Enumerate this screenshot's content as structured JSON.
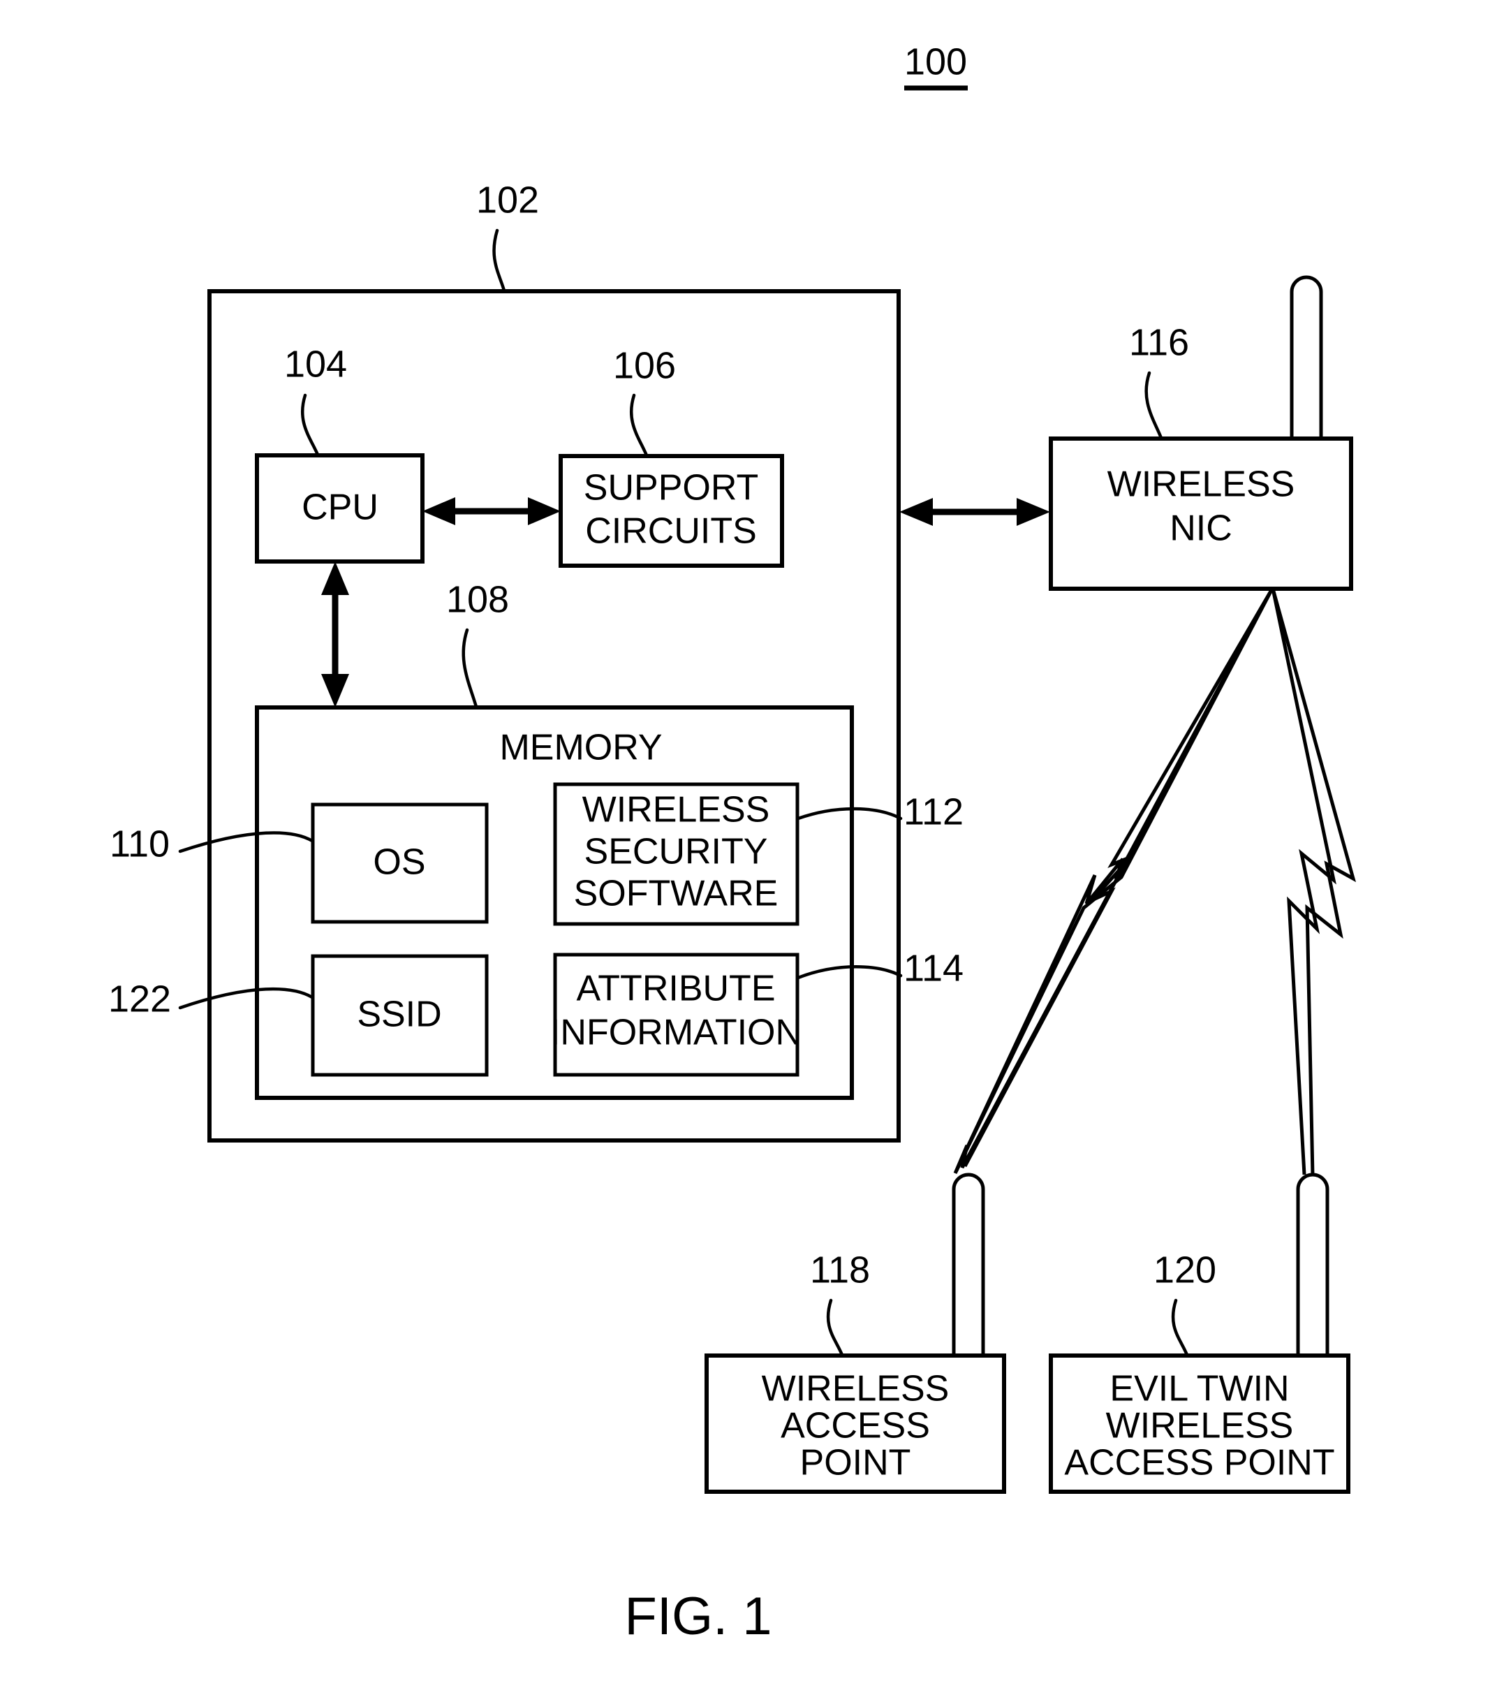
{
  "figure": {
    "caption": "FIG. 1",
    "system_ref": "100"
  },
  "blocks": {
    "computer": {
      "ref": "102",
      "label": ""
    },
    "cpu": {
      "ref": "104",
      "label": "CPU"
    },
    "support_circuits": {
      "ref": "106",
      "label_line1": "SUPPORT",
      "label_line2": "CIRCUITS"
    },
    "memory": {
      "ref": "108",
      "label": "MEMORY"
    },
    "os": {
      "ref": "110",
      "label": "OS"
    },
    "wireless_security_software": {
      "ref": "112",
      "label_line1": "WIRELESS",
      "label_line2": "SECURITY",
      "label_line3": "SOFTWARE"
    },
    "attribute_information": {
      "ref": "114",
      "label_line1": "ATTRIBUTE",
      "label_line2": "INFORMATION"
    },
    "wireless_nic": {
      "ref": "116",
      "label_line1": "WIRELESS",
      "label_line2": "NIC"
    },
    "ssid": {
      "ref": "122",
      "label": "SSID"
    },
    "wireless_access_point": {
      "ref": "118",
      "label_line1": "WIRELESS",
      "label_line2": "ACCESS",
      "label_line3": "POINT"
    },
    "evil_twin_access_point": {
      "ref": "120",
      "label_line1": "EVIL TWIN",
      "label_line2": "WIRELESS",
      "label_line3": "ACCESS POINT"
    }
  },
  "colors": {
    "stroke": "#000000",
    "background": "#ffffff"
  }
}
